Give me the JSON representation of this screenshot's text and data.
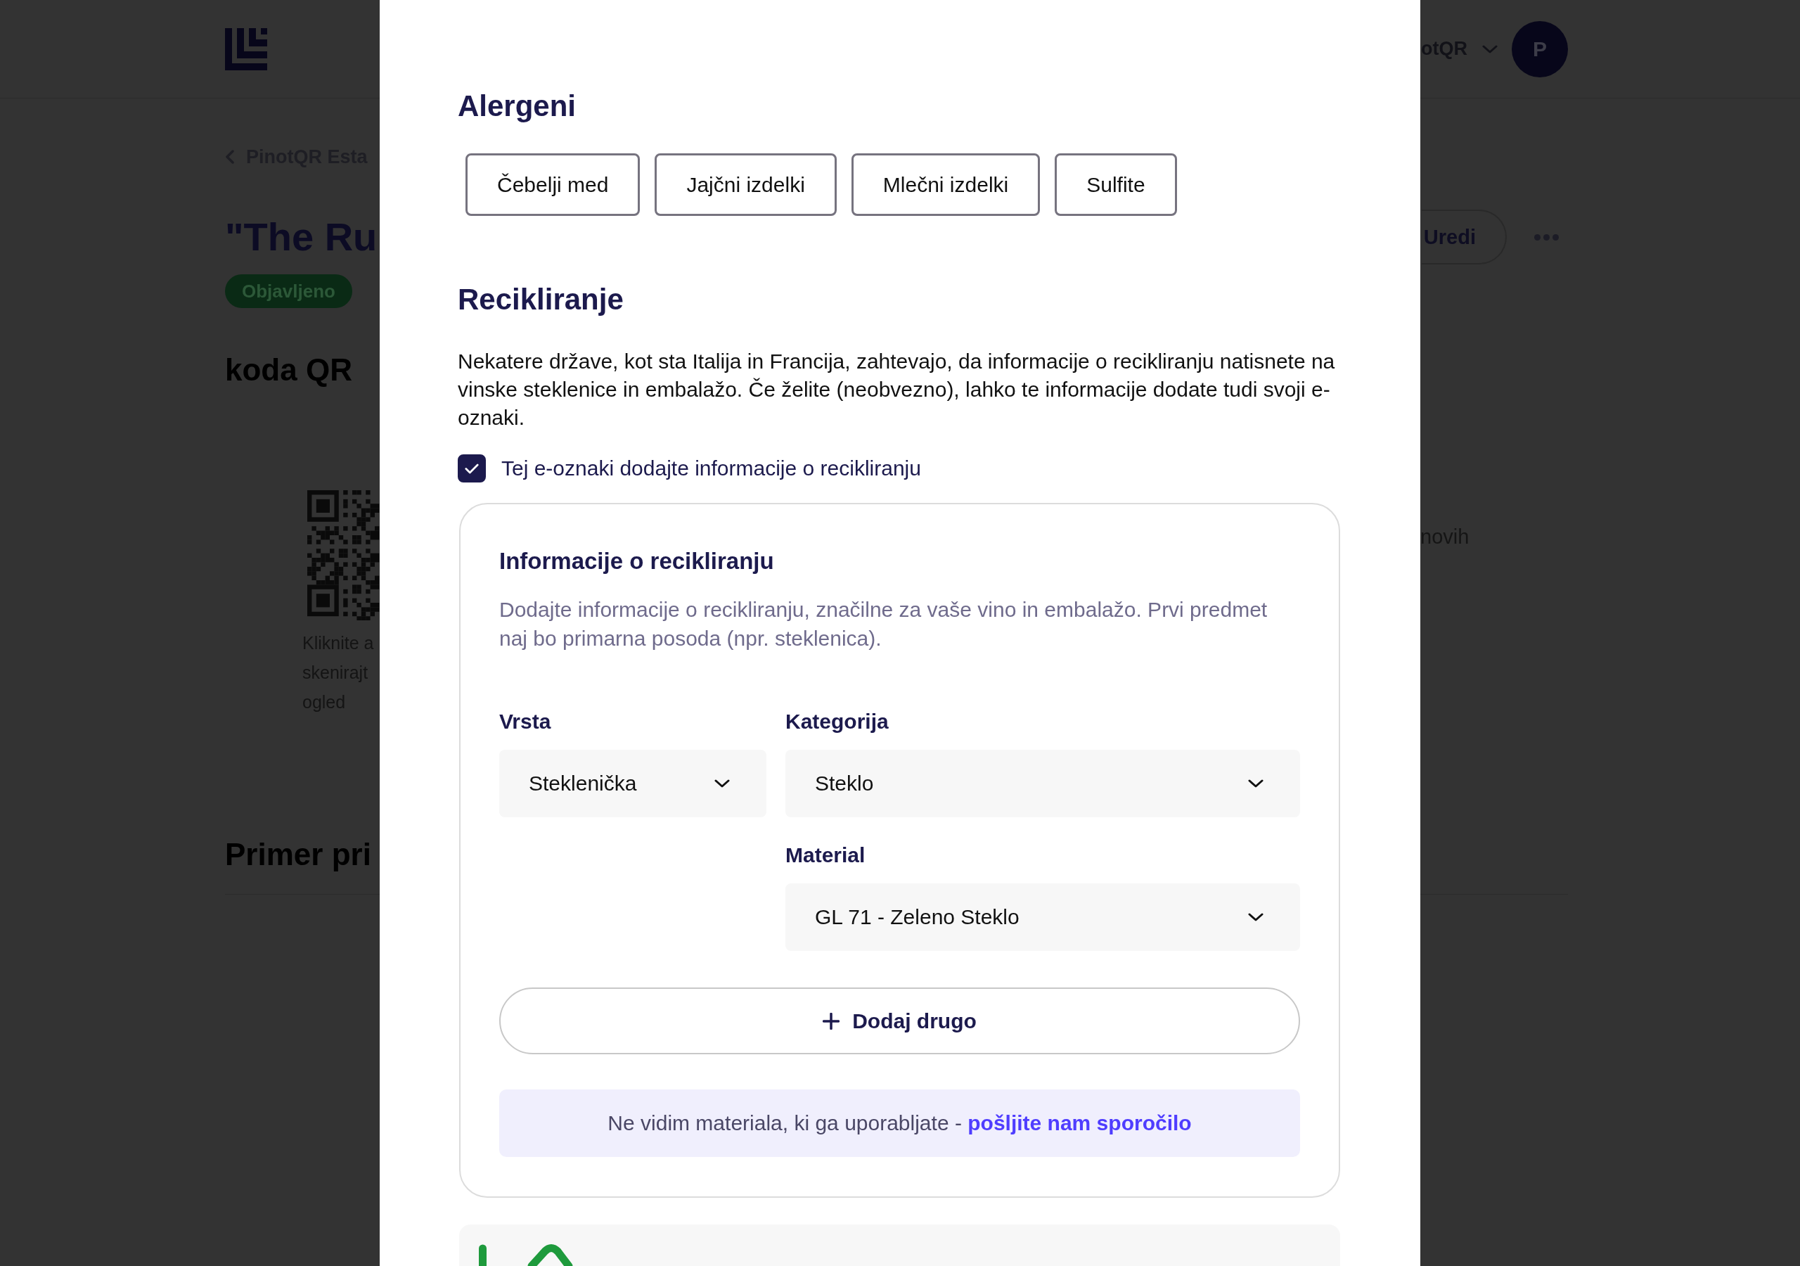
{
  "background_page": {
    "header": {
      "account_name": "otQR",
      "avatar_letter": "P"
    },
    "breadcrumb": "PinotQR Esta",
    "title": "\"The Ru",
    "status_badge": "Objavljeno",
    "edit_button": "Uredi",
    "qr_section": {
      "heading": "koda QR",
      "hint_lines": [
        "Kliknite a",
        "skenirajt",
        "ogled"
      ],
      "side_text": "novih"
    },
    "preview_heading": "Primer pri"
  },
  "modal": {
    "allergens": {
      "heading": "Alergeni",
      "items": [
        {
          "label": "Čebelji med",
          "selected": false
        },
        {
          "label": "Jajčni izdelki",
          "selected": false
        },
        {
          "label": "Mlečni izdelki",
          "selected": false
        },
        {
          "label": "Sulfite",
          "selected": false
        }
      ]
    },
    "recycling": {
      "heading": "Recikliranje",
      "description": "Nekatere države, kot sta Italija in Francija, zahtevajo, da informacije o recikliranju natisnete na vinske steklenice in embalažo. Če želite (neobvezno), lahko te informacije dodate tudi svoji e-oznaki.",
      "add_info_checkbox": {
        "label": "Tej e-oznaki dodajte informacije o recikliranju",
        "checked": true
      },
      "info_card": {
        "title": "Informacije o recikliranju",
        "description": "Dodajte informacije o recikliranju, značilne za vaše vino in embalažo. Prvi predmet naj bo primarna posoda (npr. steklenica).",
        "fields": [
          {
            "label": "Vrsta",
            "value": "Steklenička"
          },
          {
            "label": "Kategorija",
            "value": "Steklo"
          },
          {
            "label": "Material",
            "value": "GL 71 - Zeleno Steklo"
          }
        ],
        "add_button": "Dodaj drugo",
        "note": {
          "text": "Ne vidim materiala, ki ga uporabljate -",
          "link": "pošljite nam sporočilo"
        }
      }
    }
  }
}
